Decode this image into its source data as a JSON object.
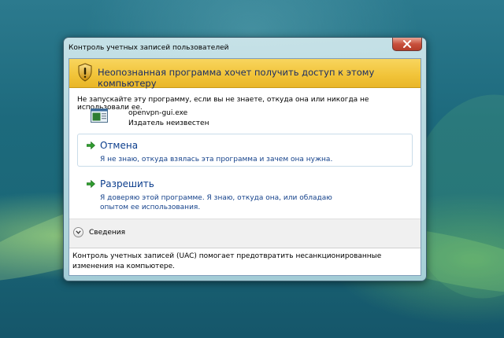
{
  "window": {
    "title": "Контроль учетных записей пользователей",
    "close_icon": "close-icon"
  },
  "banner": {
    "icon": "shield-warning-icon",
    "text": "Неопознанная программа хочет получить доступ к этому компьютеру"
  },
  "warning": "Не запускайте эту программу, если вы не знаете, откуда она или никогда не использовали ее.",
  "program": {
    "icon": "program-icon",
    "name": "openvpn-gui.exe",
    "publisher": "Издатель неизвестен"
  },
  "options": [
    {
      "icon": "green-arrow-icon",
      "title": "Отмена",
      "description": "Я не знаю, откуда взялась эта программа и зачем она нужна."
    },
    {
      "icon": "green-arrow-icon",
      "title": "Разрешить",
      "description": "Я доверяю этой программе. Я знаю, откуда она, или обладаю опытом ее использования."
    }
  ],
  "details": {
    "icon": "chevron-down-icon",
    "label": "Сведения"
  },
  "footer": "Контроль учетных записей (UAC) помогает предотвратить несанкционированные изменения на компьютере.",
  "colors": {
    "banner": "#f1c338",
    "option_title": "#0b3d8c",
    "desktop": "#1d6a7d"
  }
}
